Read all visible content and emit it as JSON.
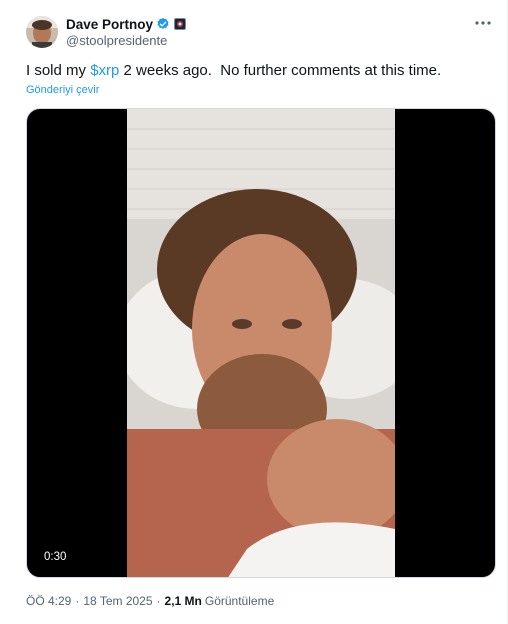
{
  "author": {
    "display_name": "Dave Portnoy",
    "handle": "@stoolpresidente"
  },
  "tweet": {
    "text_before": "I sold my ",
    "cashtag": "$xrp",
    "text_after": " 2 weeks ago.  No further comments at this time.",
    "translate_label": "Gönderiyi çevir"
  },
  "media": {
    "duration": "0:30"
  },
  "meta": {
    "time": "ÖÖ 4:29",
    "separator": "·",
    "date": "18 Tem 2025",
    "views_count": "2,1 Mn",
    "views_label": "Görüntüleme"
  },
  "colors": {
    "accent": "#1d9bf0",
    "text": "#0f1419",
    "muted": "#536471"
  },
  "icons": [
    "verified-badge-icon",
    "affiliate-badge-icon",
    "more-options-icon"
  ]
}
